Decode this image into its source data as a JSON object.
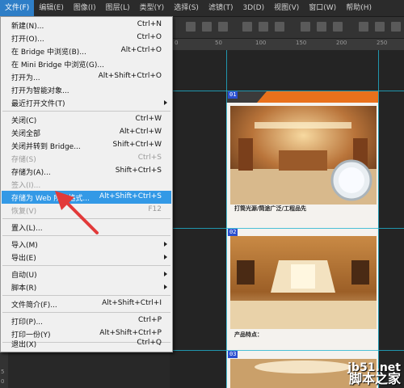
{
  "menubar": {
    "items": [
      "文件(F)",
      "编辑(E)",
      "图像(I)",
      "图层(L)",
      "类型(Y)",
      "选择(S)",
      "滤镜(T)",
      "3D(D)",
      "视图(V)",
      "窗口(W)",
      "帮助(H)"
    ]
  },
  "ruler": {
    "labels": [
      "0",
      "50",
      "100",
      "150",
      "200",
      "250"
    ],
    "vlabels": [
      "5",
      "0"
    ]
  },
  "file_menu": {
    "items": [
      {
        "label": "新建(N)...",
        "shortcut": "Ctrl+N"
      },
      {
        "label": "打开(O)...",
        "shortcut": "Ctrl+O"
      },
      {
        "label": "在 Bridge 中浏览(B)...",
        "shortcut": "Alt+Ctrl+O"
      },
      {
        "label": "在 Mini Bridge 中浏览(G)...",
        "shortcut": ""
      },
      {
        "label": "打开为...",
        "shortcut": "Alt+Shift+Ctrl+O"
      },
      {
        "label": "打开为智能对象...",
        "shortcut": ""
      },
      {
        "label": "最近打开文件(T)",
        "shortcut": ""
      },
      {
        "label": "关闭(C)",
        "shortcut": "Ctrl+W"
      },
      {
        "label": "关闭全部",
        "shortcut": "Alt+Ctrl+W"
      },
      {
        "label": "关闭并转到 Bridge...",
        "shortcut": "Shift+Ctrl+W"
      },
      {
        "label": "存储(S)",
        "shortcut": "Ctrl+S"
      },
      {
        "label": "存储为(A)...",
        "shortcut": "Shift+Ctrl+S"
      },
      {
        "label": "签入(I)...",
        "shortcut": ""
      },
      {
        "label": "存储为 Web 所用格式...",
        "shortcut": "Alt+Shift+Ctrl+S"
      },
      {
        "label": "恢复(V)",
        "shortcut": "F12"
      },
      {
        "label": "置入(L)...",
        "shortcut": ""
      },
      {
        "label": "导入(M)",
        "shortcut": ""
      },
      {
        "label": "导出(E)",
        "shortcut": ""
      },
      {
        "label": "自动(U)",
        "shortcut": ""
      },
      {
        "label": "脚本(R)",
        "shortcut": ""
      },
      {
        "label": "文件简介(F)...",
        "shortcut": "Alt+Shift+Ctrl+I"
      },
      {
        "label": "打印(P)...",
        "shortcut": "Ctrl+P"
      },
      {
        "label": "打印一份(Y)",
        "shortcut": "Alt+Shift+Ctrl+P"
      },
      {
        "label": "退出(X)",
        "shortcut": "Ctrl+Q"
      }
    ]
  },
  "canvas": {
    "slice_tags": [
      "01",
      "02",
      "03"
    ],
    "caption1_title": "打筒光源/筒途广泛/工程品先",
    "caption2_title": "产品特点："
  },
  "watermark": {
    "site": "jb51.net",
    "name": "脚本之家"
  },
  "colors": {
    "menu_highlight": "#3399e6",
    "menubar_active": "#2e7ec7",
    "guide": "#1fb3d0",
    "arrow": "#e23a3a",
    "slice_tag": "#2a4fd0"
  }
}
